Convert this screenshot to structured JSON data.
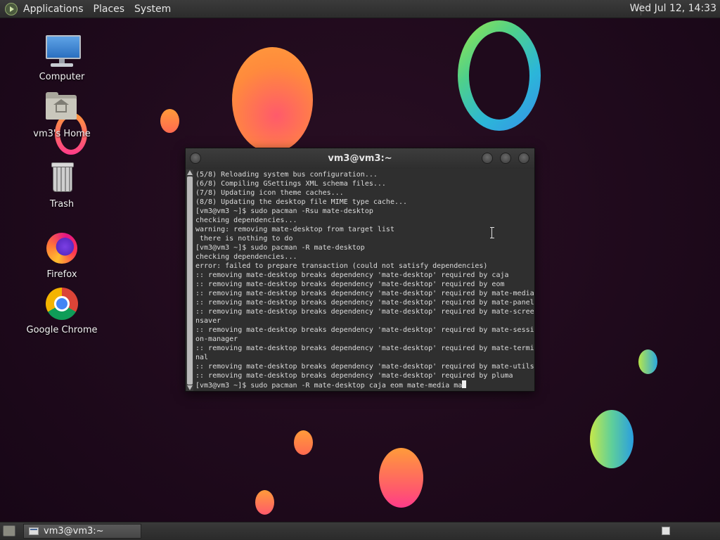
{
  "top_panel": {
    "menus": [
      "Applications",
      "Places",
      "System"
    ],
    "clock": "Wed Jul 12, 14:33"
  },
  "desktop_icons": [
    {
      "label": "Computer",
      "icon": "computer-icon"
    },
    {
      "label": "vm3's Home",
      "icon": "home-folder-icon"
    },
    {
      "label": "Trash",
      "icon": "trash-icon"
    },
    {
      "label": "Firefox",
      "icon": "firefox-icon"
    },
    {
      "label": "Google Chrome",
      "icon": "chrome-icon"
    }
  ],
  "terminal": {
    "title": "vm3@vm3:~",
    "lines": [
      "(5/8) Reloading system bus configuration...",
      "(6/8) Compiling GSettings XML schema files...",
      "(7/8) Updating icon theme caches...",
      "(8/8) Updating the desktop file MIME type cache...",
      "[vm3@vm3 ~]$ sudo pacman -Rsu mate-desktop",
      "checking dependencies...",
      "warning: removing mate-desktop from target list",
      " there is nothing to do",
      "[vm3@vm3 ~]$ sudo pacman -R mate-desktop",
      "checking dependencies...",
      "error: failed to prepare transaction (could not satisfy dependencies)",
      ":: removing mate-desktop breaks dependency 'mate-desktop' required by caja",
      ":: removing mate-desktop breaks dependency 'mate-desktop' required by eom",
      ":: removing mate-desktop breaks dependency 'mate-desktop' required by mate-media",
      ":: removing mate-desktop breaks dependency 'mate-desktop' required by mate-panel",
      ":: removing mate-desktop breaks dependency 'mate-desktop' required by mate-scree",
      "nsaver",
      ":: removing mate-desktop breaks dependency 'mate-desktop' required by mate-sessi",
      "on-manager",
      ":: removing mate-desktop breaks dependency 'mate-desktop' required by mate-termi",
      "nal",
      ":: removing mate-desktop breaks dependency 'mate-desktop' required by mate-utils",
      ":: removing mate-desktop breaks dependency 'mate-desktop' required by pluma"
    ],
    "prompt_line": "[vm3@vm3 ~]$ sudo pacman -R mate-desktop caja eom mate-media ma"
  },
  "taskbar": {
    "task_label": "vm3@vm3:~"
  },
  "colors": {
    "desktop_bg": "#1f0a1c",
    "panel_bg": "#2c2c2c",
    "terminal_bg": "#2f2f2f",
    "terminal_text": "#dcdcdc"
  }
}
